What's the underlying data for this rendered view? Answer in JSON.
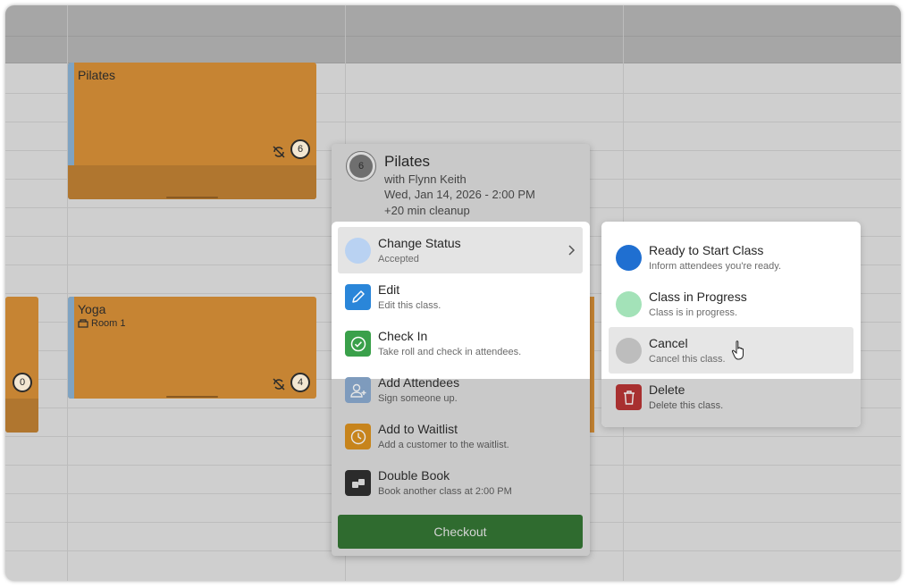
{
  "calendar": {
    "events": [
      {
        "title": "Pilates",
        "capacity": "6"
      },
      {
        "title": "Yoga",
        "room": "Room 1",
        "capacity": "4"
      },
      {
        "capacity": "0"
      }
    ]
  },
  "popover": {
    "badge_count": "6",
    "title": "Pilates",
    "instructor": "with Flynn Keith",
    "datetime": "Wed, Jan 14, 2026 - 2:00 PM",
    "cleanup": "+20 min cleanup",
    "menu": [
      {
        "label": "Change Status",
        "subtitle": "Accepted",
        "icon": "status-dot"
      },
      {
        "label": "Edit",
        "subtitle": "Edit this class.",
        "icon": "pencil-icon"
      },
      {
        "label": "Check In",
        "subtitle": "Take roll and check in attendees.",
        "icon": "check-circle-icon"
      },
      {
        "label": "Add Attendees",
        "subtitle": "Sign someone up.",
        "icon": "add-user-icon"
      },
      {
        "label": "Add to Waitlist",
        "subtitle": "Add a customer to the waitlist.",
        "icon": "clock-icon"
      },
      {
        "label": "Double Book",
        "subtitle": "Book another class at 2:00 PM",
        "icon": "double-book-icon"
      }
    ],
    "checkout_label": "Checkout"
  },
  "status_submenu": [
    {
      "label": "Ready to Start Class",
      "subtitle": "Inform attendees you're ready.",
      "color": "#1f6fd1"
    },
    {
      "label": "Class in Progress",
      "subtitle": "Class is in progress.",
      "color": "#a3e2b8"
    },
    {
      "label": "Cancel",
      "subtitle": "Cancel this class.",
      "color": "#bdbdbd"
    },
    {
      "label": "Delete",
      "subtitle": "Delete this class.",
      "color": "#a83030",
      "icon": "trash-icon"
    }
  ],
  "colors": {
    "event_orange": "#c68433",
    "checkout_green": "#2f6b2f",
    "edit_blue": "#2a86d9",
    "checkin_green": "#3aa04a"
  }
}
